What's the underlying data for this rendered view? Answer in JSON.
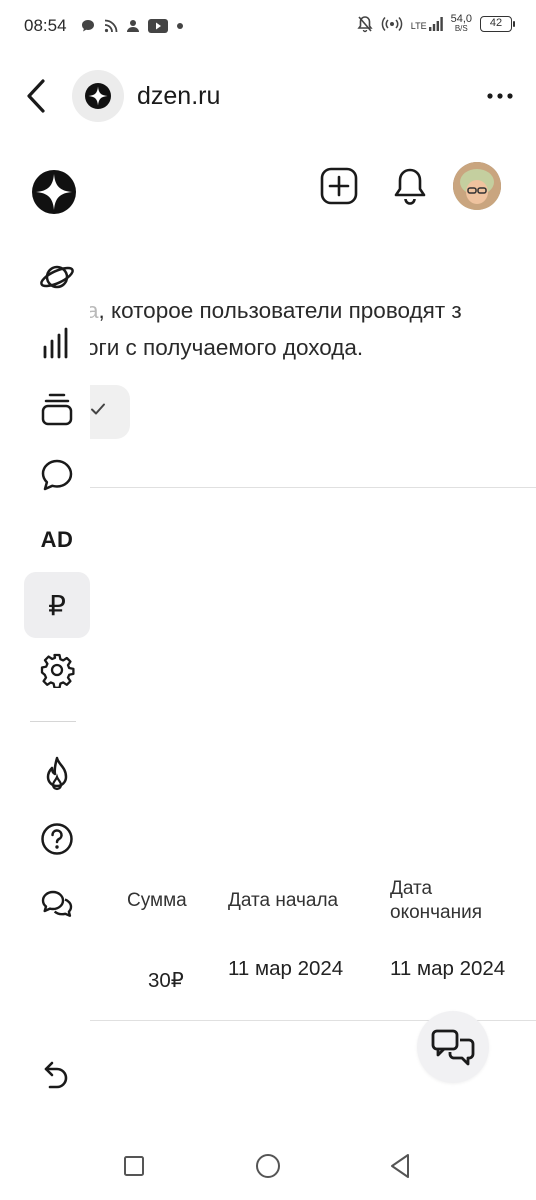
{
  "status_bar": {
    "time": "08:54",
    "network_speed_value": "54,0",
    "network_speed_unit": "B/S",
    "network_type": "LTE",
    "battery": "42"
  },
  "browser": {
    "domain": "dzen.ru"
  },
  "sidebar": {
    "ad_label": "AD",
    "ruble_label": "₽"
  },
  "content": {
    "text_line_1_faded": "а",
    "text_line_1": ", которое пользователи проводят з",
    "text_line_2": "оги с получаемого дохода."
  },
  "table": {
    "headers": [
      "Сумма",
      "Дата начала",
      "Дата окончания"
    ],
    "header_end_line1": "Дата",
    "header_end_line2": "окончания",
    "rows": [
      {
        "sum": "30₽",
        "start": "11 мар 2024",
        "end": "11 мар 2024"
      }
    ]
  },
  "colors": {
    "active_bg": "#eeeef0",
    "text": "#1f1f1f",
    "divider": "#e0e0e0"
  },
  "icons": [
    "back-arrow-icon",
    "dzen-logo-icon",
    "more-icon",
    "plus-square-icon",
    "bell-icon",
    "planet-icon",
    "stats-icon",
    "stack-icon",
    "comment-icon",
    "ruble-icon",
    "settings-icon",
    "fire-icon",
    "help-icon",
    "chats-icon",
    "undo-icon",
    "chat-bubbles-icon"
  ]
}
